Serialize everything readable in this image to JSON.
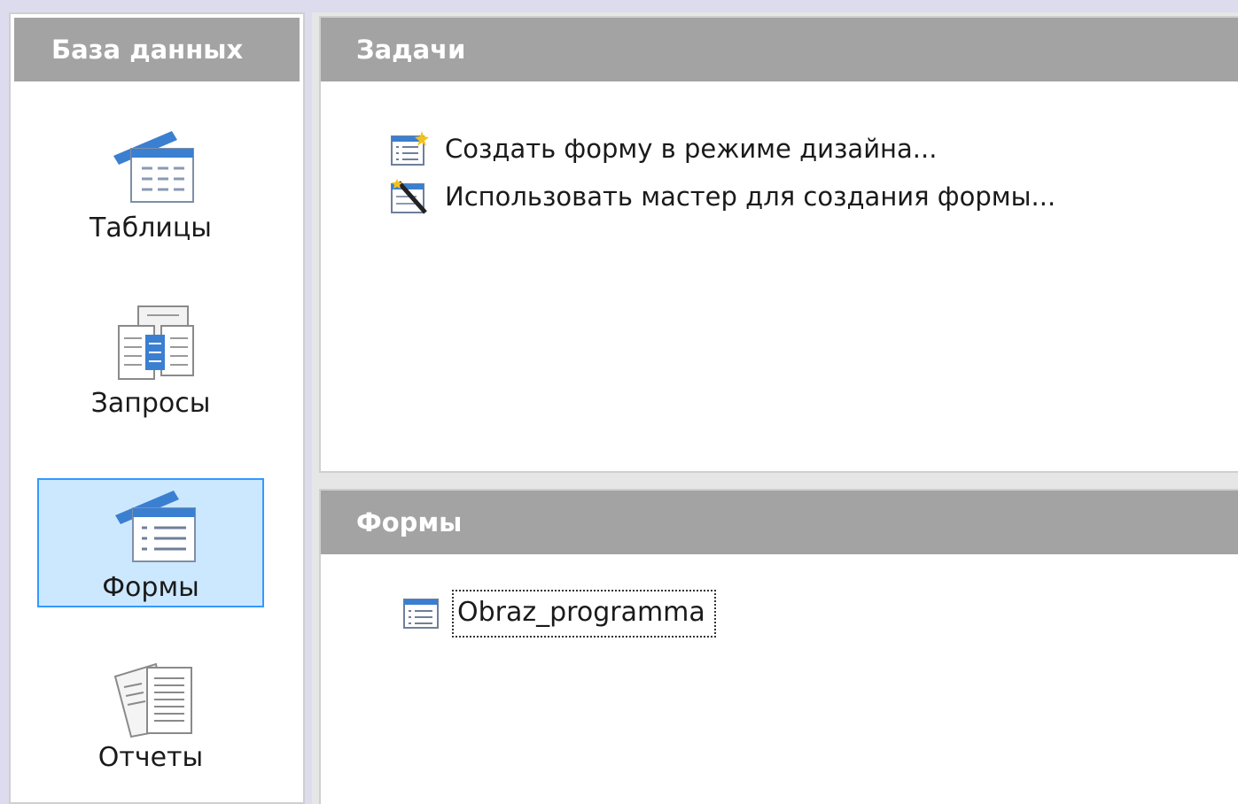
{
  "database_panel": {
    "title": "База данных",
    "items": [
      {
        "label": "Таблицы",
        "icon": "tables-icon",
        "selected": false
      },
      {
        "label": "Запросы",
        "icon": "queries-icon",
        "selected": false
      },
      {
        "label": "Формы",
        "icon": "forms-icon",
        "selected": true
      },
      {
        "label": "Отчеты",
        "icon": "reports-icon",
        "selected": false
      }
    ]
  },
  "tasks_panel": {
    "title": "Задачи",
    "items": [
      {
        "label": "Создать форму в режиме дизайна...",
        "icon": "form-design-icon"
      },
      {
        "label": "Использовать мастер для создания формы...",
        "icon": "form-wizard-icon"
      }
    ]
  },
  "forms_panel": {
    "title": "Формы",
    "items": [
      {
        "label": "Obraz_programma",
        "icon": "form-document-icon",
        "focused": true
      }
    ]
  },
  "colors": {
    "header_bg": "#a3a3a3",
    "selection_bg": "#cce8ff",
    "selection_border": "#3399ff",
    "accent_blue": "#3b7fd1"
  }
}
